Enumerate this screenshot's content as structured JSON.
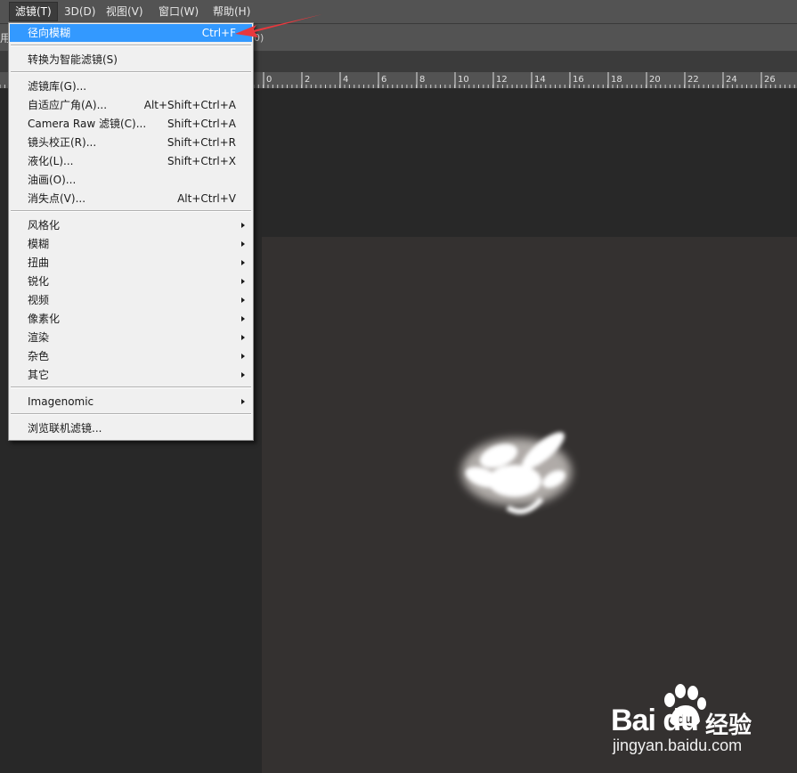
{
  "menubar": {
    "items": [
      {
        "label": "滤镜(T)"
      },
      {
        "label": "3D(D)"
      },
      {
        "label": "视图(V)"
      },
      {
        "label": "窗口(W)"
      },
      {
        "label": "帮助(H)"
      }
    ]
  },
  "optionsbar": {
    "left_fragment": "用",
    "right_fragment": "0)"
  },
  "ruler": {
    "labels": [
      "0",
      "2",
      "4",
      "6",
      "8",
      "10",
      "12",
      "14",
      "16",
      "18",
      "20",
      "22",
      "24",
      "26"
    ]
  },
  "filter_menu": {
    "last_filter": {
      "label": "径向模糊",
      "shortcut": "Ctrl+F"
    },
    "smart": {
      "label": "转换为智能滤镜(S)"
    },
    "group1": [
      {
        "label": "滤镜库(G)...",
        "shortcut": ""
      },
      {
        "label": "自适应广角(A)...",
        "shortcut": "Alt+Shift+Ctrl+A"
      },
      {
        "label": "Camera Raw 滤镜(C)...",
        "shortcut": "Shift+Ctrl+A"
      },
      {
        "label": "镜头校正(R)...",
        "shortcut": "Shift+Ctrl+R"
      },
      {
        "label": "液化(L)...",
        "shortcut": "Shift+Ctrl+X"
      },
      {
        "label": "油画(O)...",
        "shortcut": ""
      },
      {
        "label": "消失点(V)...",
        "shortcut": "Alt+Ctrl+V"
      }
    ],
    "submenus": [
      {
        "label": "风格化"
      },
      {
        "label": "模糊"
      },
      {
        "label": "扭曲"
      },
      {
        "label": "锐化"
      },
      {
        "label": "视频"
      },
      {
        "label": "像素化"
      },
      {
        "label": "渲染"
      },
      {
        "label": "杂色"
      },
      {
        "label": "其它"
      }
    ],
    "plugin": {
      "label": "Imagenomic"
    },
    "browse": {
      "label": "浏览联机滤镜..."
    }
  },
  "watermark": {
    "brand": "Bai du",
    "product": "经验",
    "url": "jingyan.baidu.com"
  },
  "colors": {
    "highlight": "#3399ff",
    "arrow": "#e8383d",
    "canvas": "#343130"
  },
  "icons": [
    "submenu-arrow-icon",
    "baidu-paw-icon",
    "red-pointer-arrow-icon"
  ]
}
